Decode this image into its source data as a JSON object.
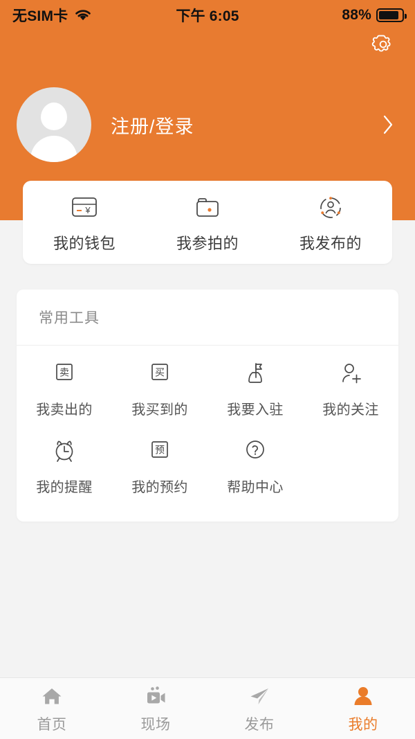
{
  "theme": {
    "brand_orange": "#e87b30",
    "accent_orange": "#ea7c2a",
    "page_background": "#f3f3f3",
    "card_background": "#ffffff",
    "icon_stroke": "#4a4a4a"
  },
  "statusbar": {
    "carrier": "无SIM卡",
    "wifi_icon": "wifi-icon",
    "time": "下午 6:05",
    "battery_percent": "88%",
    "battery_icon": "battery-icon"
  },
  "header": {
    "settings_icon": "gear-icon",
    "profile": {
      "avatar_icon": "avatar-placeholder-icon",
      "name": "注册/登录",
      "chevron_icon": "chevron-right-icon"
    }
  },
  "quick_actions": [
    {
      "label": "我的钱包",
      "icon": "wallet-card-icon"
    },
    {
      "label": "我参拍的",
      "icon": "folder-icon"
    },
    {
      "label": "我发布的",
      "icon": "person-dashed-circle-icon"
    }
  ],
  "tools": {
    "title": "常用工具",
    "items": [
      {
        "label": "我卖出的",
        "icon": "sell-box-icon",
        "glyph": "卖"
      },
      {
        "label": "我买到的",
        "icon": "buy-box-icon",
        "glyph": "买"
      },
      {
        "label": "我要入驻",
        "icon": "flag-hill-icon",
        "glyph": ""
      },
      {
        "label": "我的关注",
        "icon": "person-plus-icon",
        "glyph": ""
      },
      {
        "label": "我的提醒",
        "icon": "alarm-clock-icon",
        "glyph": ""
      },
      {
        "label": "我的预约",
        "icon": "reserve-box-icon",
        "glyph": "预"
      },
      {
        "label": "帮助中心",
        "icon": "question-circle-icon",
        "glyph": ""
      }
    ]
  },
  "tabbar": {
    "items": [
      {
        "label": "首页",
        "icon": "home-icon",
        "active": false
      },
      {
        "label": "现场",
        "icon": "video-camera-icon",
        "active": false
      },
      {
        "label": "发布",
        "icon": "paper-plane-icon",
        "active": false
      },
      {
        "label": "我的",
        "icon": "person-icon",
        "active": true
      }
    ]
  }
}
